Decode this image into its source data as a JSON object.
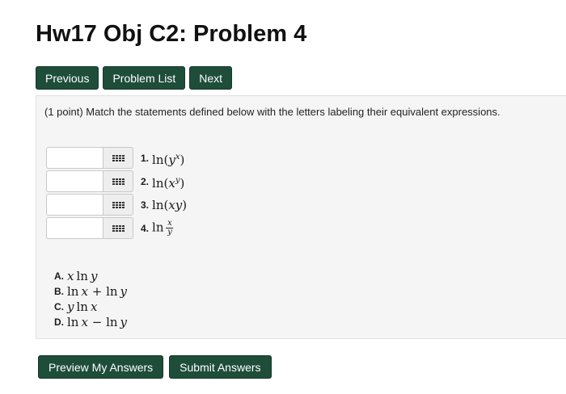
{
  "page": {
    "title": "Hw17 Obj C2: Problem 4"
  },
  "nav": {
    "previous": "Previous",
    "problem_list": "Problem List",
    "next": "Next"
  },
  "problem": {
    "prompt": "(1 point) Match the statements defined below with the letters labeling their equivalent expressions.",
    "statements": [
      {
        "num": "1.",
        "fn": "ln",
        "lp": "(",
        "base": "y",
        "exp": "x",
        "rp": ")"
      },
      {
        "num": "2.",
        "fn": "ln",
        "lp": "(",
        "base": "x",
        "exp": "y",
        "rp": ")"
      },
      {
        "num": "3.",
        "fn": "ln",
        "lp": "(",
        "arg": "xy",
        "rp": ")"
      },
      {
        "num": "4.",
        "fn": "ln",
        "frac_num": "x",
        "frac_den": "y"
      }
    ],
    "options": [
      {
        "letter": "A.",
        "a": "x",
        "fn": "ln",
        "b": "y"
      },
      {
        "letter": "B.",
        "fn1": "ln",
        "a": "x",
        "op": "+",
        "fn2": "ln",
        "b": "y"
      },
      {
        "letter": "C.",
        "a": "y",
        "fn": "ln",
        "b": "x"
      },
      {
        "letter": "D.",
        "fn1": "ln",
        "a": "x",
        "op": "−",
        "fn2": "ln",
        "b": "y"
      }
    ]
  },
  "actions": {
    "preview": "Preview My Answers",
    "submit": "Submit Answers"
  },
  "colors": {
    "button_bg": "#1e4d3a",
    "panel_bg": "#f5f5f5"
  },
  "icons": {
    "picker": "grid-icon"
  }
}
